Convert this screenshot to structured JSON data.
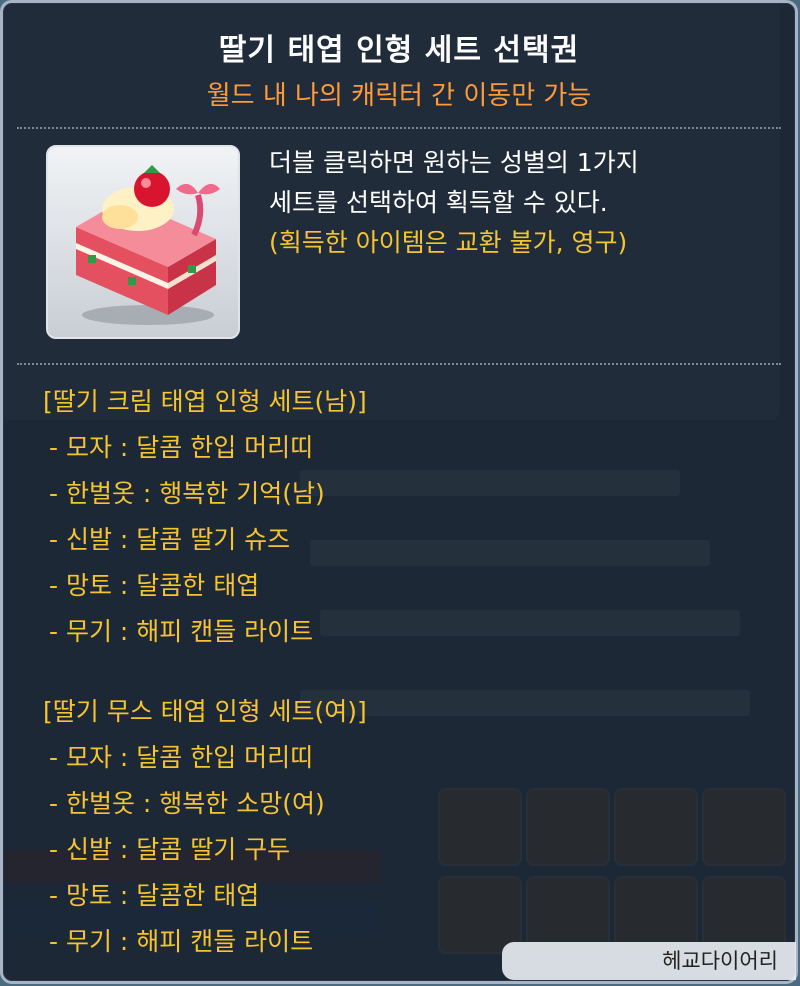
{
  "tooltip": {
    "title": "딸기 태엽 인형 세트 선택권",
    "subtitle": "월드 내 나의 캐릭터 간 이동만 가능",
    "item_icon": "strawberry-cake-icon",
    "description": {
      "line1": "더블 클릭하면 원하는 성별의 1가지",
      "line2": "세트를 선택하여 획득할 수 있다.",
      "note": "(획득한 아이템은 교환 불가, 영구)"
    },
    "sections": [
      {
        "title": "[딸기 크림 태엽 인형 세트(남)]",
        "items": [
          "- 모자 : 달콤 한입 머리띠",
          "- 한벌옷 : 행복한 기억(남)",
          "- 신발 : 달콤 딸기 슈즈",
          "- 망토 : 달콤한 태엽",
          "- 무기 : 해피 캔들 라이트"
        ]
      },
      {
        "title": "[딸기 무스 태엽 인형 세트(여)]",
        "items": [
          "- 모자 : 달콤 한입 머리띠",
          "- 한벌옷 : 행복한 소망(여)",
          "- 신발 : 달콤 딸기 구두",
          "- 망토 : 달콤한 태엽",
          "- 무기 : 해피 캔들 라이트"
        ]
      }
    ]
  },
  "corner_label": "헤교다이어리",
  "colors": {
    "title": "#ffffff",
    "subtitle": "#ff9a3a",
    "note": "#f6c431",
    "tooltip_bg": "#121a26"
  }
}
